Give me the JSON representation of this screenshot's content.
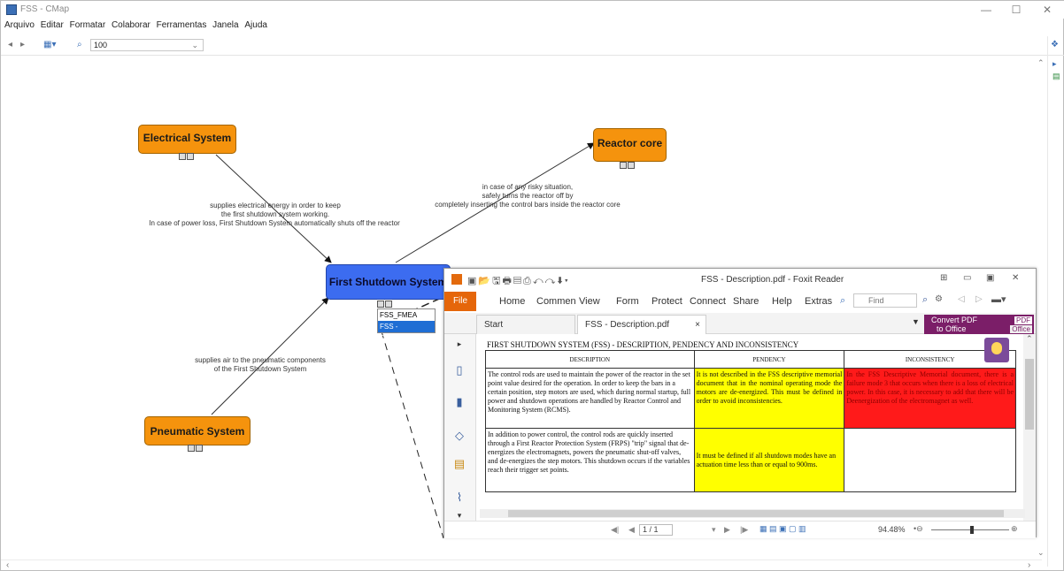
{
  "window": {
    "title": "FSS - CMap",
    "minimize": "—",
    "maximize": "☐",
    "close": "✕"
  },
  "menu": [
    "Arquivo",
    "Editar",
    "Formatar",
    "Colaborar",
    "Ferramentas",
    "Janela",
    "Ajuda"
  ],
  "toolbar": {
    "zoom_value": "100"
  },
  "map": {
    "nodes": {
      "electrical": "Electrical System",
      "reactor": "Reactor core",
      "shutdown": "First Shutdown System",
      "pneumatic": "Pneumatic System"
    },
    "links": {
      "electrical_l1": "supplies electrical energy in order to keep",
      "electrical_l2": "the first shutdown system working.",
      "electrical_l3": "In case of power loss, First Shutdown System automatically shuts off the reactor",
      "reactor_l1": "in case of any risky situation,",
      "reactor_l2": "safely turns the reactor off by",
      "reactor_l3": "completely inserting the control bars inside the reactor core",
      "pneumatic_l1": "supplies air to the pneumatic components",
      "pneumatic_l2": "of the First Shutdown System"
    },
    "resource_menu": {
      "item1": "FSS_FMEA",
      "item2": "FSS - Description"
    }
  },
  "foxit": {
    "title": "FSS - Description.pdf - Foxit Reader",
    "quick_access": "▣📂🖫🖶▤⎙↶↷⬇▾",
    "ribbon": {
      "file": "File",
      "tabs": [
        "Home",
        "Commen",
        "View",
        "Form",
        "Protect",
        "Connect",
        "Share",
        "Help",
        "Extras"
      ],
      "find_placeholder": "Find"
    },
    "doc_tabs": {
      "start": "Start",
      "current": "FSS - Description.pdf",
      "close": "×"
    },
    "convert": {
      "line1": "Convert PDF",
      "line2": "to Office",
      "pdf": "PDF",
      "office": "Office"
    },
    "document": {
      "heading": "FIRST SHUTDOWN SYSTEM (FSS) - DESCRIPTION, PENDENCY AND INCONSISTENCY",
      "columns": [
        "DESCRIPTION",
        "PENDENCY",
        "INCONSISTENCY"
      ],
      "row1": {
        "description": "The control rods are used to maintain the power of the reactor in the set point value desired for the operation. In order to keep the bars in a certain position, step motors are used, which during normal startup, full power and shutdown operations are handled by Reactor Control and Monitoring System (RCMS).",
        "pendency": "It is not described in the FSS descriptive memorial document that in the nominal operating mode the motors are de-energized. This must be defined in order to avoid inconsistencies.",
        "inconsistency": "In the FSS Descriptive Memorial document, there is a failure mode 3 that occurs when there is a loss of electrical power. In this case, it is necessary to add that there will be Deenergization of the electromagnet as well."
      },
      "row2": {
        "description": "In addition to power control, the control rods are quickly inserted through a First Reactor Protection System (FRPS) \"trip\" signal that de-energizes the electromagnets, powers the pneumatic shut-off valves, and de-energizes the step motors. This shutdown occurs if the variables reach their trigger set points.",
        "pendency": "It must be defined if all shutdown modes have an actuation time less than or equal to 900ms.",
        "inconsistency": ""
      }
    },
    "status": {
      "page": "1 / 1",
      "zoom": "94.48%"
    },
    "colors": {
      "pendency": "#ffff00",
      "inconsistency": "#ff0000",
      "brand": "#e5660a",
      "convert": "#7b1e68"
    }
  }
}
